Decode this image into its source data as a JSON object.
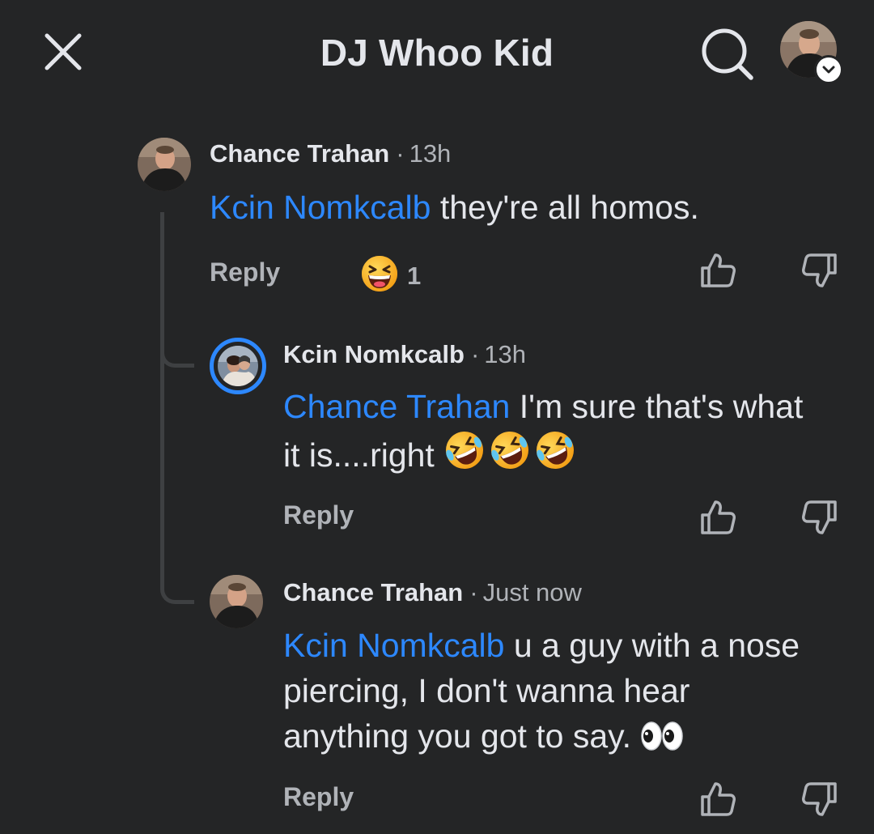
{
  "header": {
    "title": "DJ Whoo Kid"
  },
  "icons": {
    "close": "close-icon",
    "search": "search-icon",
    "chevron": "chevron-down-icon",
    "like": "thumbs-up-icon",
    "dislike": "thumbs-down-icon",
    "laugh": "grinning-squinting-emoji",
    "rofl": "rolling-on-floor-laughing-emoji",
    "eyes": "eyes-emoji"
  },
  "colors": {
    "background": "#242526",
    "mention": "#2d88ff",
    "secondary_text": "#b0b3b8",
    "primary_text": "#e4e6eb"
  },
  "comments": [
    {
      "author": "Chance Trahan",
      "separator": "·",
      "time": "13h",
      "mention": "Kcin Nomkcalb",
      "text": " they're all homos.",
      "reply_label": "Reply",
      "reaction_count": "1"
    },
    {
      "author": "Kcin Nomkcalb",
      "separator": "·",
      "time": "13h",
      "mention": "Chance Trahan",
      "text_line1": " I'm sure that's what",
      "text_line2": "it is....right ",
      "reply_label": "Reply"
    },
    {
      "author": "Chance Trahan",
      "separator": "·",
      "time": "Just now",
      "mention": "Kcin Nomkcalb",
      "text_line1": " u a guy with a nose",
      "text_line2": "piercing, I don't wanna hear",
      "text_line3": "anything you got to say. ",
      "reply_label": "Reply"
    }
  ]
}
